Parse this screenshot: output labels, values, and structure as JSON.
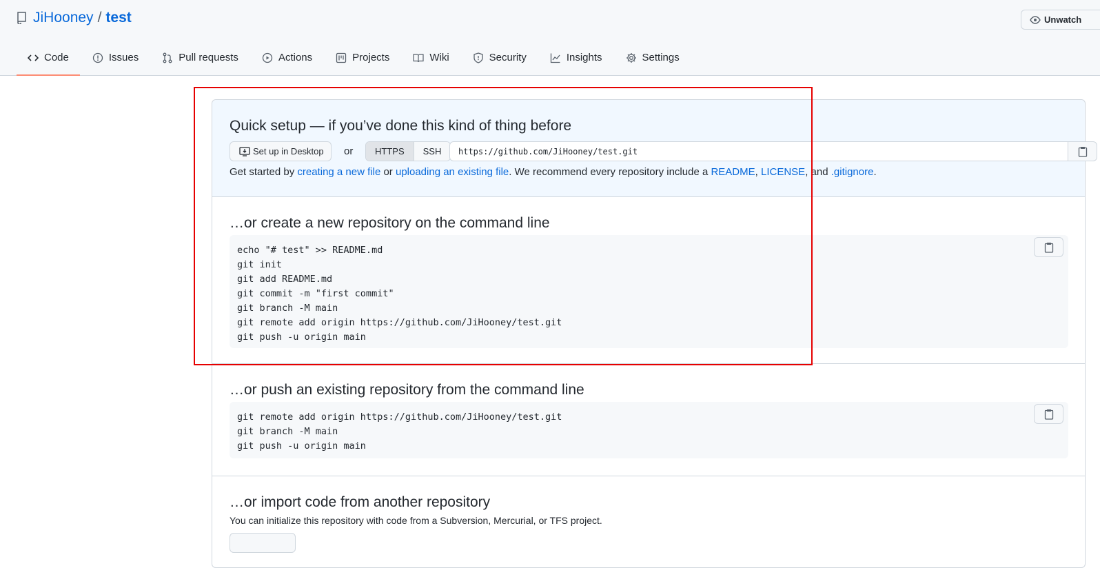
{
  "header": {
    "owner": "JiHooney",
    "separator": "/",
    "repo": "test",
    "unwatch_label": "Unwatch"
  },
  "tabs": [
    {
      "label": "Code",
      "icon": "code-icon"
    },
    {
      "label": "Issues",
      "icon": "issue-icon"
    },
    {
      "label": "Pull requests",
      "icon": "pull-request-icon"
    },
    {
      "label": "Actions",
      "icon": "play-icon"
    },
    {
      "label": "Projects",
      "icon": "project-icon"
    },
    {
      "label": "Wiki",
      "icon": "book-icon"
    },
    {
      "label": "Security",
      "icon": "shield-icon"
    },
    {
      "label": "Insights",
      "icon": "graph-icon"
    },
    {
      "label": "Settings",
      "icon": "gear-icon"
    }
  ],
  "quick_setup": {
    "title": "Quick setup — if you’ve done this kind of thing before",
    "setup_desktop_label": "Set up in Desktop",
    "or_label": "or",
    "https_label": "HTTPS",
    "ssh_label": "SSH",
    "url": "https://github.com/JiHooney/test.git",
    "help_prefix": "Get started by ",
    "help_link1": "creating a new file",
    "help_or": " or ",
    "help_link2": "uploading an existing file",
    "help_mid": ". We recommend every repository include a ",
    "help_link3": "README",
    "help_comma": ", ",
    "help_link4": "LICENSE",
    "help_and": ", and ",
    "help_link5": ".gitignore",
    "help_end": "."
  },
  "new_repo": {
    "title": "…or create a new repository on the command line",
    "lines": [
      "echo \"# test\" >> README.md",
      "git init",
      "git add README.md",
      "git commit -m \"first commit\"",
      "git branch -M main",
      "git remote add origin https://github.com/JiHooney/test.git",
      "git push -u origin main"
    ]
  },
  "push_repo": {
    "title": "…or push an existing repository from the command line",
    "lines": [
      "git remote add origin https://github.com/JiHooney/test.git",
      "git branch -M main",
      "git push -u origin main"
    ]
  },
  "import_repo": {
    "title": "…or import code from another repository",
    "text": "You can initialize this repository with code from a Subversion, Mercurial, or TFS project."
  }
}
